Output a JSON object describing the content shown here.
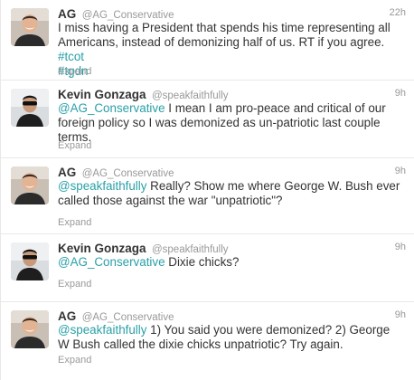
{
  "tweets": [
    {
      "name": "AG",
      "handle": "@AG_Conservative",
      "time": "22h",
      "text_before": "I miss having a President that spends his time representing all Americans, instead of demonizing half of us. RT if you agree. ",
      "hashtag1": "#tcot",
      "hashtag2": "#tgdn",
      "expand": "Expand",
      "avatar_icon": "profile-photo-man-smiling"
    },
    {
      "name": "Kevin Gonzaga",
      "handle": "@speakfaithfully",
      "time": "9h",
      "mention": "@AG_Conservative",
      "text_after": " I mean I am pro-peace and critical of our foreign policy so I was demonized as un-patriotic last couple terms.",
      "expand": "Expand",
      "avatar_icon": "profile-photo-man-sunglasses"
    },
    {
      "name": "AG",
      "handle": "@AG_Conservative",
      "time": "9h",
      "mention": "@speakfaithfully",
      "text_after": " Really? Show me where George W. Bush ever called those against the war \"unpatriotic\"?",
      "expand": "Expand",
      "avatar_icon": "profile-photo-man-smiling"
    },
    {
      "name": "Kevin Gonzaga",
      "handle": "@speakfaithfully",
      "time": "9h",
      "mention": "@AG_Conservative",
      "text_after": " Dixie chicks?",
      "expand": "Expand",
      "avatar_icon": "profile-photo-man-sunglasses"
    },
    {
      "name": "AG",
      "handle": "@AG_Conservative",
      "time": "9h",
      "mention": "@speakfaithfully",
      "text_after": " 1) You said you were demonized? 2) George W Bush called the dixie chicks unpatriotic? Try again.",
      "expand": "Expand",
      "avatar_icon": "profile-photo-man-smiling"
    }
  ],
  "colors": {
    "link": "#2aa0a8",
    "meta": "#999999",
    "text": "#333333",
    "divider": "#e8e8e8"
  }
}
